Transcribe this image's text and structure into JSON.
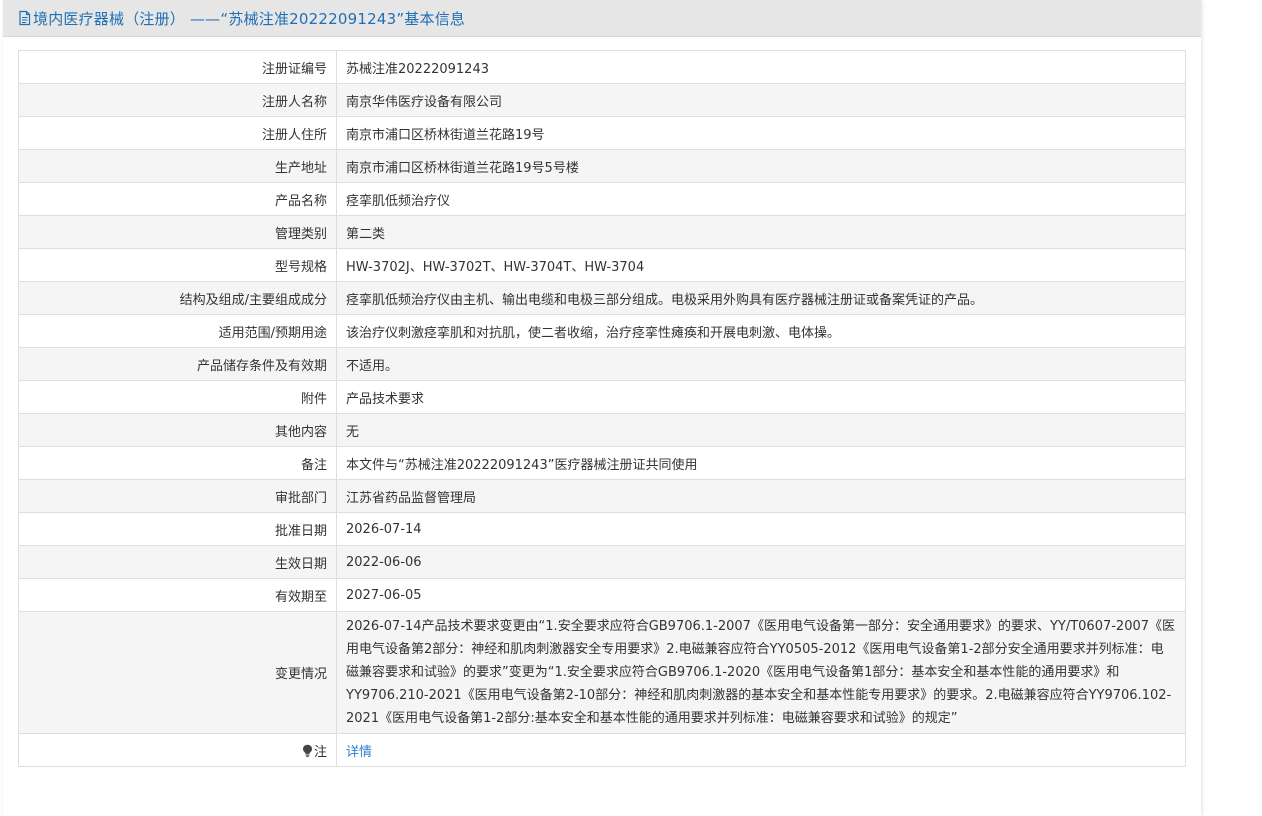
{
  "header": {
    "title": "境内医疗器械（注册） ——“苏械注准20222091243”基本信息"
  },
  "rows": [
    {
      "label": "注册证编号",
      "value": "苏械注准20222091243"
    },
    {
      "label": "注册人名称",
      "value": "南京华伟医疗设备有限公司"
    },
    {
      "label": "注册人住所",
      "value": "南京市浦口区桥林街道兰花路19号"
    },
    {
      "label": "生产地址",
      "value": "南京市浦口区桥林街道兰花路19号5号楼"
    },
    {
      "label": "产品名称",
      "value": "痉挛肌低频治疗仪"
    },
    {
      "label": "管理类别",
      "value": "第二类"
    },
    {
      "label": "型号规格",
      "value": "HW-3702J、HW-3702T、HW-3704T、HW-3704"
    },
    {
      "label": "结构及组成/主要组成成分",
      "value": "痉挛肌低频治疗仪由主机、输出电缆和电极三部分组成。电极采用外购具有医疗器械注册证或备案凭证的产品。"
    },
    {
      "label": "适用范围/预期用途",
      "value": "该治疗仪刺激痉挛肌和对抗肌，使二者收缩，治疗痉挛性瘫痪和开展电刺激、电体操。"
    },
    {
      "label": "产品储存条件及有效期",
      "value": "不适用。"
    },
    {
      "label": "附件",
      "value": "产品技术要求"
    },
    {
      "label": "其他内容",
      "value": "无"
    },
    {
      "label": "备注",
      "value": "本文件与“苏械注准20222091243”医疗器械注册证共同使用"
    },
    {
      "label": "审批部门",
      "value": "江苏省药品监督管理局"
    },
    {
      "label": "批准日期",
      "value": "2026-07-14"
    },
    {
      "label": "生效日期",
      "value": "2022-06-06"
    },
    {
      "label": "有效期至",
      "value": "2027-06-05"
    },
    {
      "label": "变更情况",
      "value": "2026-07-14产品技术要求变更由“1.安全要求应符合GB9706.1-2007《医用电气设备第一部分：安全通用要求》的要求、YY/T0607-2007《医用电气设备第2部分：神经和肌肉刺激器安全专用要求》2.电磁兼容应符合YY0505-2012《医用电气设备第1-2部分安全通用要求并列标准：电磁兼容要求和试验》的要求”变更为“1.安全要求应符合GB9706.1-2020《医用电气设备第1部分：基本安全和基本性能的通用要求》和YY9706.210-2021《医用电气设备第2-10部分：神经和肌肉刺激器的基本安全和基本性能专用要求》的要求。2.电磁兼容应符合YY9706.102-2021《医用电气设备第1-2部分:基本安全和基本性能的通用要求并列标准：电磁兼容要求和试验》的规定”"
    }
  ],
  "note": {
    "label": "注",
    "link": "详情"
  },
  "colors": {
    "title": "#1f6fb5",
    "link": "#2d7fd0",
    "header_bg": "#e6e6e6",
    "row_alt": "#f5f5f5",
    "border": "#dedede"
  },
  "icons": {
    "header": "document-icon",
    "note": "lightbulb-icon"
  }
}
